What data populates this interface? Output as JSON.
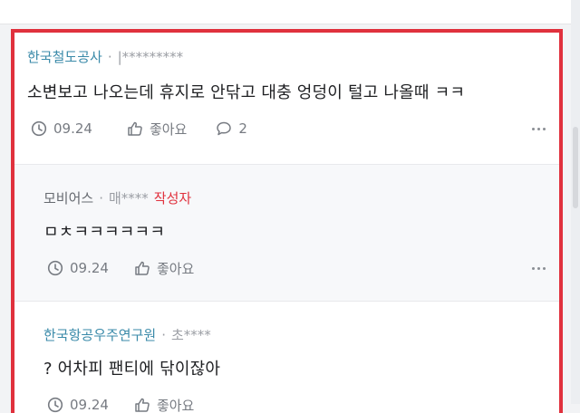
{
  "comments": [
    {
      "author": "한국철도공사",
      "masked_id": "|*********",
      "text": "소변보고 나오는데 휴지로 안닦고 대충 엉덩이 털고 나올때 ㅋㅋ",
      "time": "09.24",
      "like_label": "좋아요",
      "reply_count": "2"
    },
    {
      "author": "모비어스",
      "masked_id": "매****",
      "badge": "작성자",
      "text": "ㅁㅊㅋㅋㅋㅋㅋㅋ",
      "time": "09.24",
      "like_label": "좋아요"
    },
    {
      "author": "한국항공우주연구원",
      "masked_id": "초****",
      "text": "? 어차피 팬티에 닦이잖아",
      "time": "09.24",
      "like_label": "좋아요"
    }
  ],
  "icons": {
    "time": "clock-icon",
    "like": "thumbs-up-icon",
    "reply": "speech-bubble-icon",
    "more": "more-dots-icon"
  },
  "colors": {
    "highlight_border": "#e0313d",
    "author_link": "#3a8aa9",
    "author_badge": "#e0313d"
  }
}
